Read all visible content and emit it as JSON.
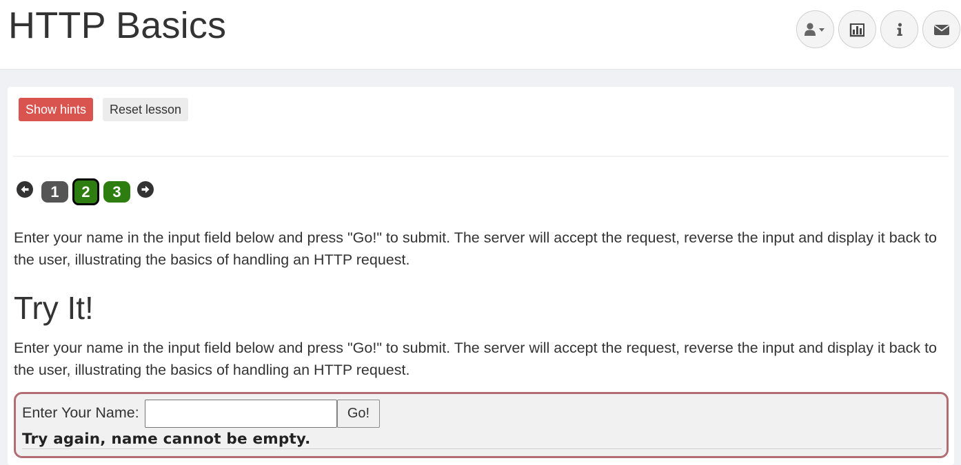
{
  "header": {
    "title": "HTTP Basics",
    "icons": [
      "user-menu-icon",
      "report-card-icon",
      "about-info-icon",
      "contact-mail-icon"
    ]
  },
  "toolbar": {
    "show_hints_label": "Show hints",
    "reset_lesson_label": "Reset lesson"
  },
  "pager": {
    "pages": [
      "1",
      "2",
      "3"
    ],
    "current_page": "2",
    "colors": {
      "visited": "#555555",
      "complete": "#2e7d10"
    }
  },
  "content": {
    "intro": "Enter your name in the input field below and press \"Go!\" to submit. The server will accept the request, reverse the input and display it back to the user, illustrating the basics of handling an HTTP request.",
    "heading": "Try It!",
    "body": "Enter your name in the input field below and press \"Go!\" to submit. The server will accept the request, reverse the input and display it back to the user, illustrating the basics of handling an HTTP request."
  },
  "form": {
    "name_label": "Enter Your Name:",
    "name_value": "",
    "go_label": "Go!",
    "feedback": "Try again, name cannot be empty."
  },
  "colors": {
    "accent_red": "#d9534f",
    "form_border": "#b26d72"
  }
}
